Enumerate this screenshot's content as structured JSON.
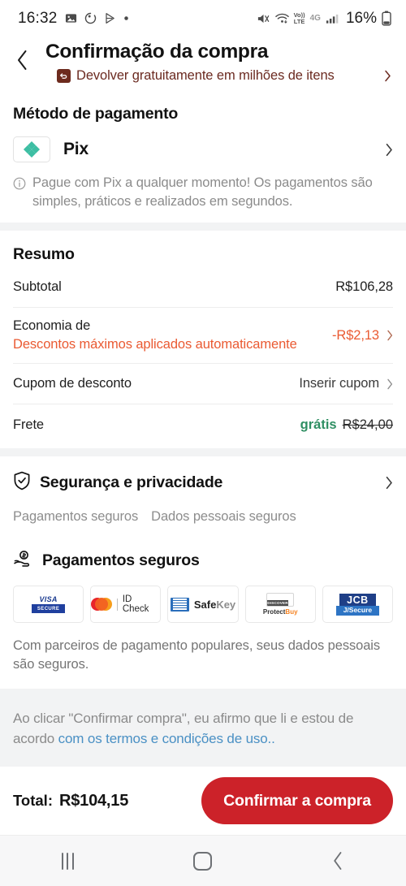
{
  "status_bar": {
    "time": "16:32",
    "left_icons": [
      "photo-icon",
      "spinner-icon",
      "play-store-icon",
      "dot-icon"
    ],
    "right_icons": [
      "mute-icon",
      "wifi-icon",
      "volte-icon",
      "signal-icon"
    ],
    "volte_label": "Vo))",
    "volte_sub": "LTE",
    "network": "4G",
    "battery_percent": "16%"
  },
  "header": {
    "back_icon": "chevron-left-icon",
    "title": "Confirmação da compra",
    "return_badge_icon": "return-arrow-icon",
    "return_text": "Devolver gratuitamente em milhões de itens",
    "return_chevron": "chevron-right-icon",
    "return_color": "#6b2a20"
  },
  "payment_method": {
    "section_title": "Método de pagamento",
    "logo_icon": "pix-logo-icon",
    "logo_color": "#3DBEA3",
    "name": "Pix",
    "chevron": "chevron-right-icon",
    "info_icon": "info-circle-icon",
    "note": "Pague com Pix a qualquer momento! Os pagamentos são simples, práticos e realizados em segundos."
  },
  "summary": {
    "title": "Resumo",
    "rows": [
      {
        "label": "Subtotal",
        "sublabel": "",
        "value": "R$106,28",
        "chevron": false
      },
      {
        "label": "Economia de",
        "sublabel": "Descontos máximos aplicados automaticamente",
        "value": "-R$2,13",
        "chevron": true
      },
      {
        "label": "Cupom de desconto",
        "sublabel": "",
        "value": "Inserir cupom",
        "chevron": true
      }
    ],
    "shipping": {
      "label": "Frete",
      "free_label": "grátis",
      "original_price": "R$24,00"
    },
    "discount_color": "#ea5a32",
    "free_color": "#2f8f63"
  },
  "security": {
    "icon": "shield-check-icon",
    "title": "Segurança e privacidade",
    "chevron": "chevron-right-icon",
    "tags": [
      "Pagamentos seguros",
      "Dados pessoais seguros"
    ]
  },
  "secure_payments": {
    "icon": "hand-coin-icon",
    "title": "Pagamentos seguros",
    "badges": [
      {
        "name": "visa-secure-badge",
        "brand": "VISA",
        "sub": "SECURE"
      },
      {
        "name": "mastercard-id-check-badge",
        "brand": "Mastercard",
        "sub": "ID Check"
      },
      {
        "name": "amex-safekey-badge",
        "brand": "AMERICAN EXPRESS",
        "sub": "SafeKey"
      },
      {
        "name": "discover-protectbuy-badge",
        "brand": "DISCOVER",
        "sub": "ProtectBuy"
      },
      {
        "name": "jcb-jsecure-badge",
        "brand": "JCB",
        "sub": "J/Secure"
      }
    ],
    "note": "Com parceiros de pagamento populares, seus dados pessoais são seguros."
  },
  "disclaimer": {
    "text_before": "Ao clicar \"Confirmar compra\", eu afirmo que li e estou de acordo ",
    "link_text": "com os termos e condições de uso..",
    "link_color": "#4a90c4"
  },
  "bottom_bar": {
    "total_label": "Total:",
    "total_value": "R$104,15",
    "confirm_label": "Confirmar a compra",
    "confirm_color": "#cc2229"
  },
  "nav_bar": {
    "recents": "recents-icon",
    "home": "home-icon",
    "back": "back-icon"
  }
}
